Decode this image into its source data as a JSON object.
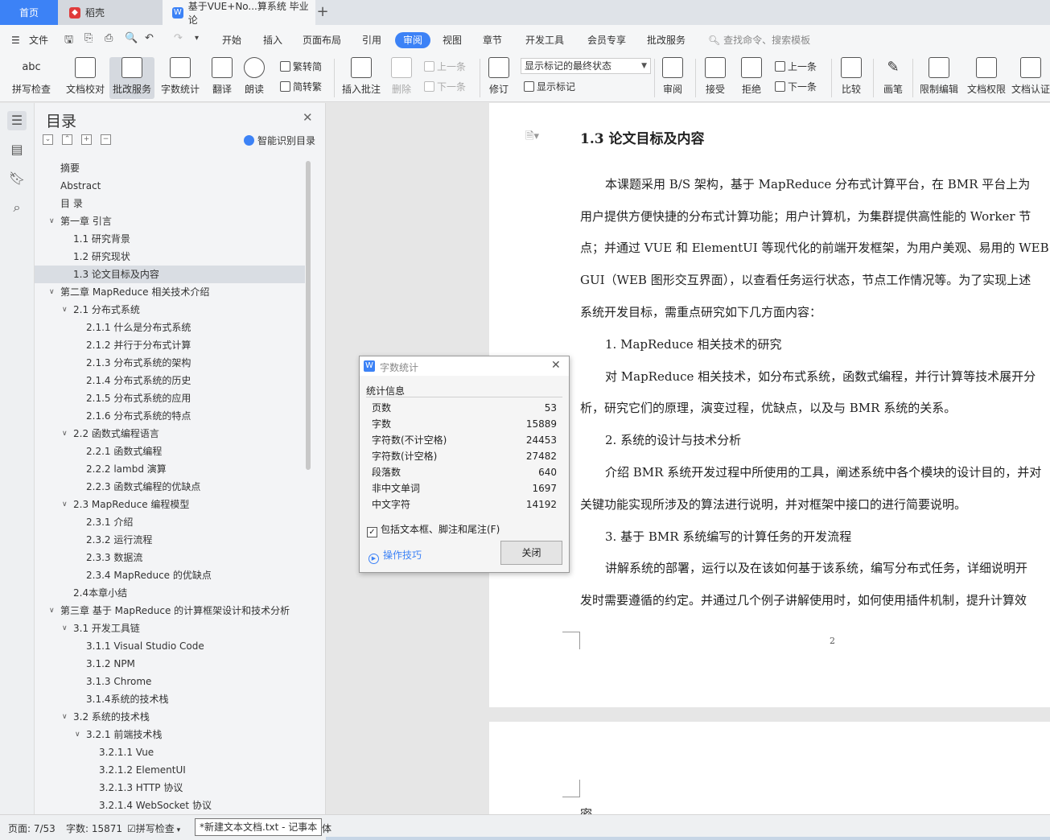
{
  "tabs": {
    "home": "首页",
    "daoke": "稻壳",
    "doc": "基于VUE+No...算系统 毕业论",
    "new_tab": "+"
  },
  "menu": {
    "file": "文件",
    "items": [
      "开始",
      "插入",
      "页面布局",
      "引用",
      "审阅",
      "视图",
      "章节",
      "开发工具",
      "会员专享",
      "批改服务"
    ],
    "active": "审阅",
    "search_placeholder": "查找命令、搜索模板"
  },
  "ribbon": {
    "spellcheck": "拼写检查",
    "proofread": "文档校对",
    "correction_service": "批改服务",
    "word_count": "字数统计",
    "translate": "翻译",
    "read_aloud": "朗读",
    "trad_to_simp": "繁转简",
    "simp_to_trad": "简转繁",
    "insert_comment": "插入批注",
    "delete": "删除",
    "prev_comment": "上一条",
    "next_comment": "下一条",
    "track_changes": "修订",
    "markup_state": "显示标记的最终状态",
    "show_markup": "显示标记",
    "review": "审阅",
    "accept": "接受",
    "reject": "拒绝",
    "prev_change": "上一条",
    "next_change": "下一条",
    "compare": "比较",
    "pen": "画笔",
    "restrict_edit": "限制编辑",
    "doc_rights": "文档权限",
    "doc_auth": "文档认证"
  },
  "toc": {
    "title": "目录",
    "smart": "智能识别目录",
    "items": [
      {
        "label": "摘要",
        "level": 0,
        "toggle": ""
      },
      {
        "label": "Abstract",
        "level": 0,
        "toggle": ""
      },
      {
        "label": "目 录",
        "level": 0,
        "toggle": ""
      },
      {
        "label": "第一章 引言",
        "level": 0,
        "toggle": "v"
      },
      {
        "label": "1.1  研究背景",
        "level": 1,
        "toggle": ""
      },
      {
        "label": "1.2  研究现状",
        "level": 1,
        "toggle": ""
      },
      {
        "label": "1.3  论文目标及内容",
        "level": 1,
        "toggle": "",
        "selected": true
      },
      {
        "label": "第二章 MapReduce 相关技术介绍",
        "level": 0,
        "toggle": "v"
      },
      {
        "label": "2.1  分布式系统",
        "level": 1,
        "toggle": "v"
      },
      {
        "label": "2.1.1  什么是分布式系统",
        "level": 2,
        "toggle": ""
      },
      {
        "label": "2.1.2  并行于分布式计算",
        "level": 2,
        "toggle": ""
      },
      {
        "label": "2.1.3  分布式系统的架构",
        "level": 2,
        "toggle": ""
      },
      {
        "label": "2.1.4  分布式系统的历史",
        "level": 2,
        "toggle": ""
      },
      {
        "label": "2.1.5  分布式系统的应用",
        "level": 2,
        "toggle": ""
      },
      {
        "label": "2.1.6  分布式系统的特点",
        "level": 2,
        "toggle": ""
      },
      {
        "label": "2.2  函数式编程语言",
        "level": 1,
        "toggle": "v"
      },
      {
        "label": "2.2.1  函数式编程",
        "level": 2,
        "toggle": ""
      },
      {
        "label": "2.2.2  lambd 演算",
        "level": 2,
        "toggle": ""
      },
      {
        "label": "2.2.3  函数式编程的优缺点",
        "level": 2,
        "toggle": ""
      },
      {
        "label": "2.3  MapReduce  编程模型",
        "level": 1,
        "toggle": "v"
      },
      {
        "label": "2.3.1  介绍",
        "level": 2,
        "toggle": ""
      },
      {
        "label": "2.3.2  运行流程",
        "level": 2,
        "toggle": ""
      },
      {
        "label": "2.3.3  数据流",
        "level": 2,
        "toggle": ""
      },
      {
        "label": "2.3.4  MapReduce 的优缺点",
        "level": 2,
        "toggle": ""
      },
      {
        "label": "2.4本章小结",
        "level": 1,
        "toggle": ""
      },
      {
        "label": "第三章 基于 MapReduce 的计算框架设计和技术分析",
        "level": 0,
        "toggle": "v"
      },
      {
        "label": "3.1  开发工具链",
        "level": 1,
        "toggle": "v"
      },
      {
        "label": "3.1.1  Visual Studio Code",
        "level": 2,
        "toggle": ""
      },
      {
        "label": "3.1.2  NPM",
        "level": 2,
        "toggle": ""
      },
      {
        "label": "3.1.3  Chrome",
        "level": 2,
        "toggle": ""
      },
      {
        "label": "3.1.4系统的技术栈",
        "level": 2,
        "toggle": ""
      },
      {
        "label": "3.2  系统的技术栈",
        "level": 1,
        "toggle": "v"
      },
      {
        "label": "3.2.1  前端技术栈",
        "level": 2,
        "toggle": "v"
      },
      {
        "label": "3.2.1.1  Vue",
        "level": 3,
        "toggle": ""
      },
      {
        "label": "3.2.1.2  ElementUI",
        "level": 3,
        "toggle": ""
      },
      {
        "label": "3.2.1.3  HTTP 协议",
        "level": 3,
        "toggle": ""
      },
      {
        "label": "3.2.1.4  WebSocket 协议",
        "level": 3,
        "toggle": ""
      }
    ]
  },
  "document": {
    "heading": "1.3  论文目标及内容",
    "lines": [
      "本课题采用 B/S 架构，基于 MapReduce 分布式计算平台，在 BMR 平台上为",
      "用户提供方便快捷的分布式计算功能；用户计算机，为集群提供高性能的 Worker 节",
      "点；并通过 VUE 和 ElementUI 等现代化的前端开发框架，为用户美观、易用的 WEB",
      "GUI（WEB 图形交互界面），以查看任务运行状态，节点工作情况等。为了实现上述",
      "系统开发目标，需重点研究如下几方面内容：",
      "1.   MapReduce 相关技术的研究",
      "对 MapReduce 相关技术，如分布式系统，函数式编程，并行计算等技术展开分",
      "析，研究它们的原理，演变过程，优缺点，以及与 BMR 系统的关系。",
      "2.   系统的设计与技术分析",
      "介绍 BMR 系统开发过程中所使用的工具，阐述系统中各个模块的设计目的，并对",
      "关键功能实现所涉及的算法进行说明，并对框架中接口的进行简要说明。",
      "3.   基于 BMR 系统编写的计算任务的开发流程",
      "讲解系统的部署，运行以及在该如何基于该系统，编写分布式任务，详细说明开",
      "发时需要遵循的约定。并通过几个例子讲解使用时，如何使用插件机制，提升计算效"
    ],
    "page_number": "2",
    "page2_text": "密"
  },
  "dialog": {
    "title": "字数统计",
    "section": "统计信息",
    "stats": [
      {
        "label": "页数",
        "value": "53"
      },
      {
        "label": "字数",
        "value": "15889"
      },
      {
        "label": "字符数(不计空格)",
        "value": "24453"
      },
      {
        "label": "字符数(计空格)",
        "value": "27482"
      },
      {
        "label": "段落数",
        "value": "640"
      },
      {
        "label": "非中文单词",
        "value": "1697"
      },
      {
        "label": "中文字符",
        "value": "14192"
      }
    ],
    "checkbox_label": "包括文本框、脚注和尾注(F)",
    "checkbox_checked": true,
    "tips": "操作技巧",
    "close": "关闭"
  },
  "status": {
    "page": "页面: 7/53",
    "words": "字数: 15871",
    "spellcheck": "拼写检查",
    "tooltip": "*新建文本文档.txt - 记事本",
    "cut_text": "体"
  },
  "colors": {
    "accent": "#3c82f6",
    "spellcheck_underline": "#d33"
  }
}
